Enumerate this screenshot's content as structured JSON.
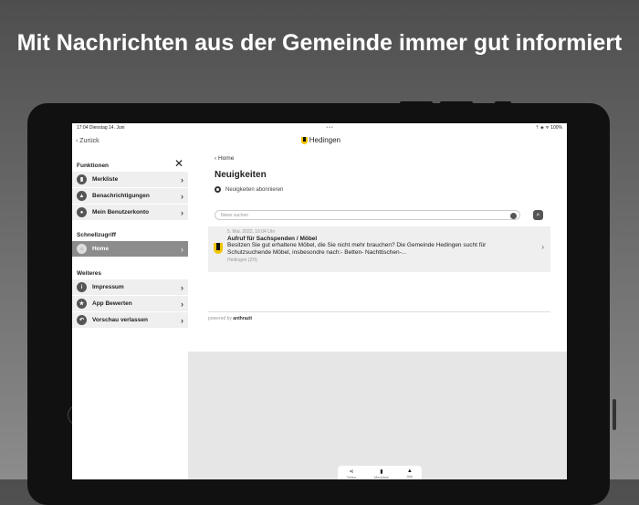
{
  "headline": "Mit Nachrichten aus der Gemeinde immer gut informiert",
  "status_bar": {
    "time_date": "17:04  Dienstag 14. Juni",
    "dots": "•••",
    "battery": "⇡ ◈ ᯤ 100%"
  },
  "nav": {
    "back_label": "Zurück",
    "logo_text": "Hedingen"
  },
  "sidebar": {
    "sections": [
      {
        "title": "Funktionen",
        "items": [
          {
            "label": "Merkliste",
            "icon": "▮"
          },
          {
            "label": "Benachrichtigungen",
            "icon": "▲"
          },
          {
            "label": "Mein Benutzerkonto",
            "icon": "●"
          }
        ]
      },
      {
        "title": "Schnellzugriff",
        "items": [
          {
            "label": "Home",
            "icon": "⌂"
          }
        ]
      },
      {
        "title": "Weiteres",
        "items": [
          {
            "label": "Impressum",
            "icon": "i"
          },
          {
            "label": "App Bewerten",
            "icon": "★"
          },
          {
            "label": "Vorschau verlassen",
            "icon": "↶"
          }
        ]
      }
    ]
  },
  "main": {
    "breadcrumb": "Home",
    "title": "Neuigkeiten",
    "subscribe_label": "Neuigkeiten abonnieren",
    "search_placeholder": "News suchen",
    "news": [
      {
        "date": "5. Mai. 2022, 16:04 Uhr",
        "title": "Aufruf für Sachspenden / Möbel",
        "body": "Besitzen Sie gut erhaltene Möbel, die Sie nicht mehr brauchen? Die Gemeinde Hedingen sucht für Schutzsuchende Möbel, insbesondre nach:- Betten- Nachttischen-...",
        "source": "Hedingen (ZH)"
      }
    ],
    "powered_by": "powered by",
    "powered_brand": "anthrazit"
  },
  "tabbar": [
    {
      "label": "Teilen",
      "icon": "⋖"
    },
    {
      "label": "Merkliste",
      "icon": "▮"
    },
    {
      "label": "Alle",
      "icon": "▲"
    }
  ]
}
